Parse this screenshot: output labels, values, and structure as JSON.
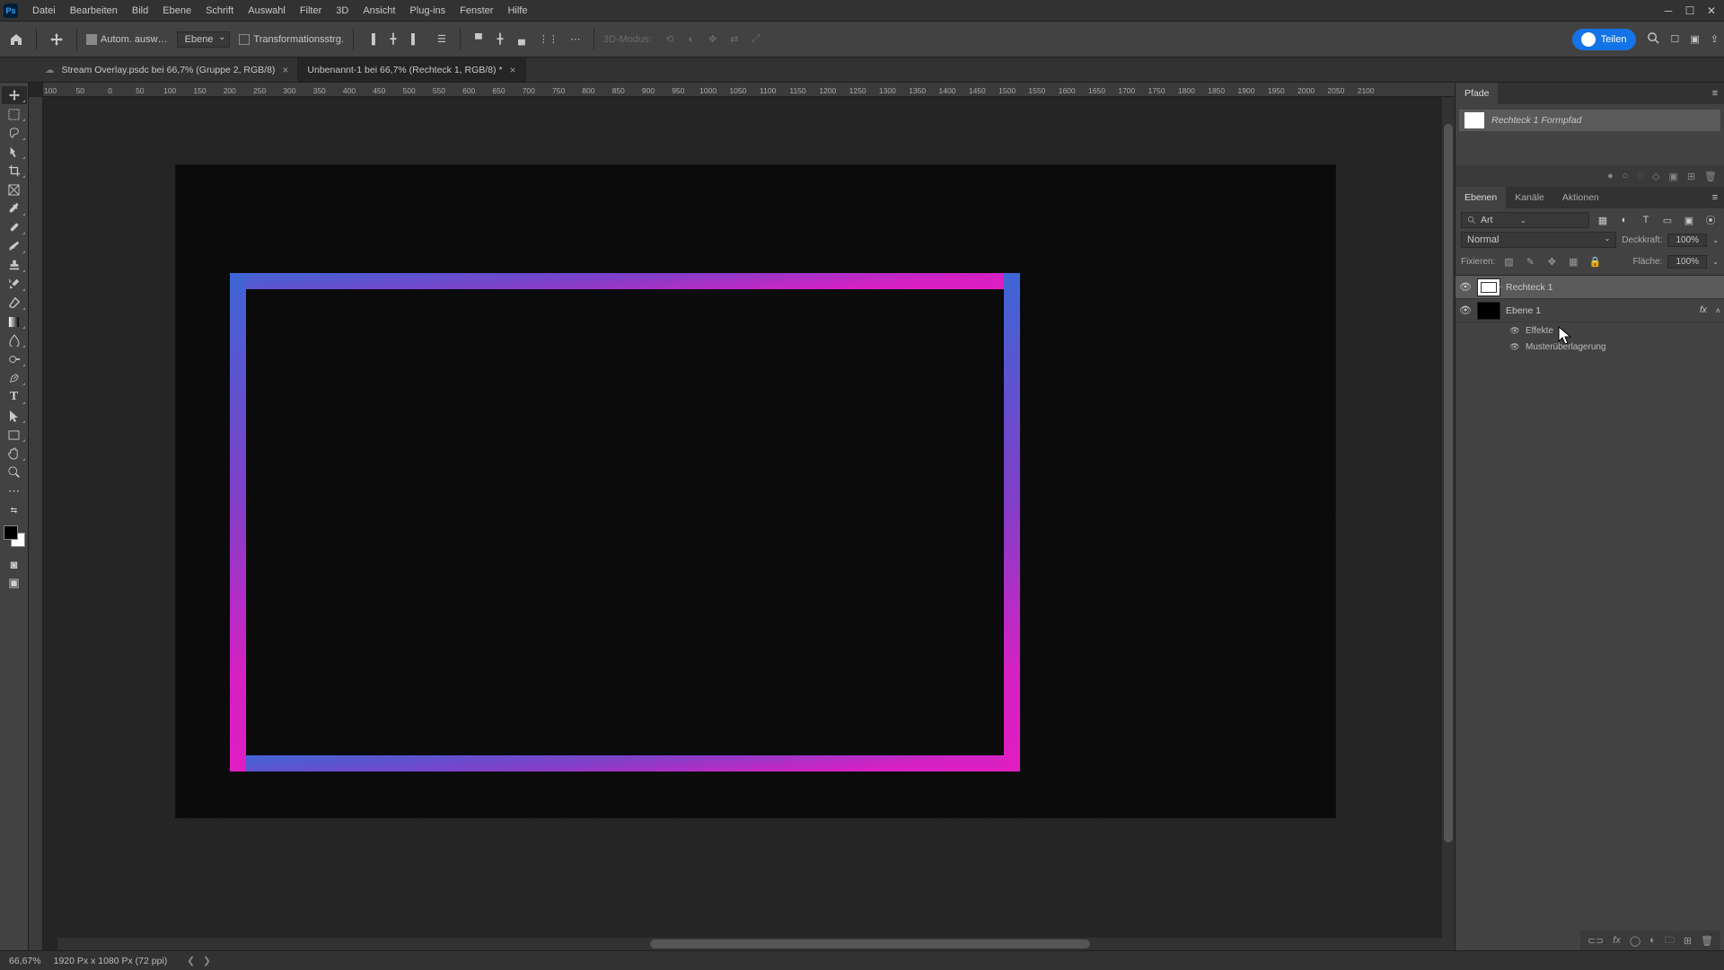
{
  "menu": {
    "items": [
      "Datei",
      "Bearbeiten",
      "Bild",
      "Ebene",
      "Schrift",
      "Auswahl",
      "Filter",
      "3D",
      "Ansicht",
      "Plug-ins",
      "Fenster",
      "Hilfe"
    ]
  },
  "options": {
    "auto_select": "Autom. ausw…",
    "layer_kind": "Ebene",
    "transform": "Transformationsstrg.",
    "three_d_mode": "3D-Modus:",
    "share": "Teilen"
  },
  "tabs": [
    {
      "label": "Stream Overlay.psdc bei 66,7% (Gruppe 2, RGB/8)",
      "cloud": true,
      "active": false
    },
    {
      "label": "Unbenannt-1 bei 66,7% (Rechteck 1, RGB/8) *",
      "cloud": false,
      "active": true
    }
  ],
  "ruler_marks": [
    "100",
    "50",
    "0",
    "50",
    "100",
    "150",
    "200",
    "250",
    "300",
    "350",
    "400",
    "450",
    "500",
    "550",
    "600",
    "650",
    "700",
    "750",
    "800",
    "850",
    "900",
    "950",
    "1000",
    "1050",
    "1100",
    "1150",
    "1200",
    "1250",
    "1300",
    "1350",
    "1400",
    "1450",
    "1500",
    "1550",
    "1600",
    "1650",
    "1700",
    "1750",
    "1800",
    "1850",
    "1900",
    "1950",
    "2000",
    "2050",
    "2100"
  ],
  "paths_panel": {
    "tab": "Pfade",
    "item": "Rechteck 1 Formpfad"
  },
  "layers_panel": {
    "tabs": [
      "Ebenen",
      "Kanäle",
      "Aktionen"
    ],
    "filter_label": "Art",
    "blend_mode": "Normal",
    "opacity_label": "Deckkraft:",
    "opacity_value": "100%",
    "lock_label": "Fixieren:",
    "fill_label": "Fläche:",
    "fill_value": "100%",
    "layers": [
      {
        "name": "Rechteck 1",
        "selected": true,
        "shape": true
      },
      {
        "name": "Ebene 1",
        "selected": false,
        "shape": false,
        "fx": "fx"
      }
    ],
    "effects_label": "Effekte",
    "effect_item": "Musterüberlagerung"
  },
  "status": {
    "zoom": "66,67%",
    "doc_info": "1920 Px x 1080 Px (72 ppi)"
  },
  "colors": {
    "grad_top": "#3e66d6",
    "grad_bottom": "#e01ec1"
  }
}
